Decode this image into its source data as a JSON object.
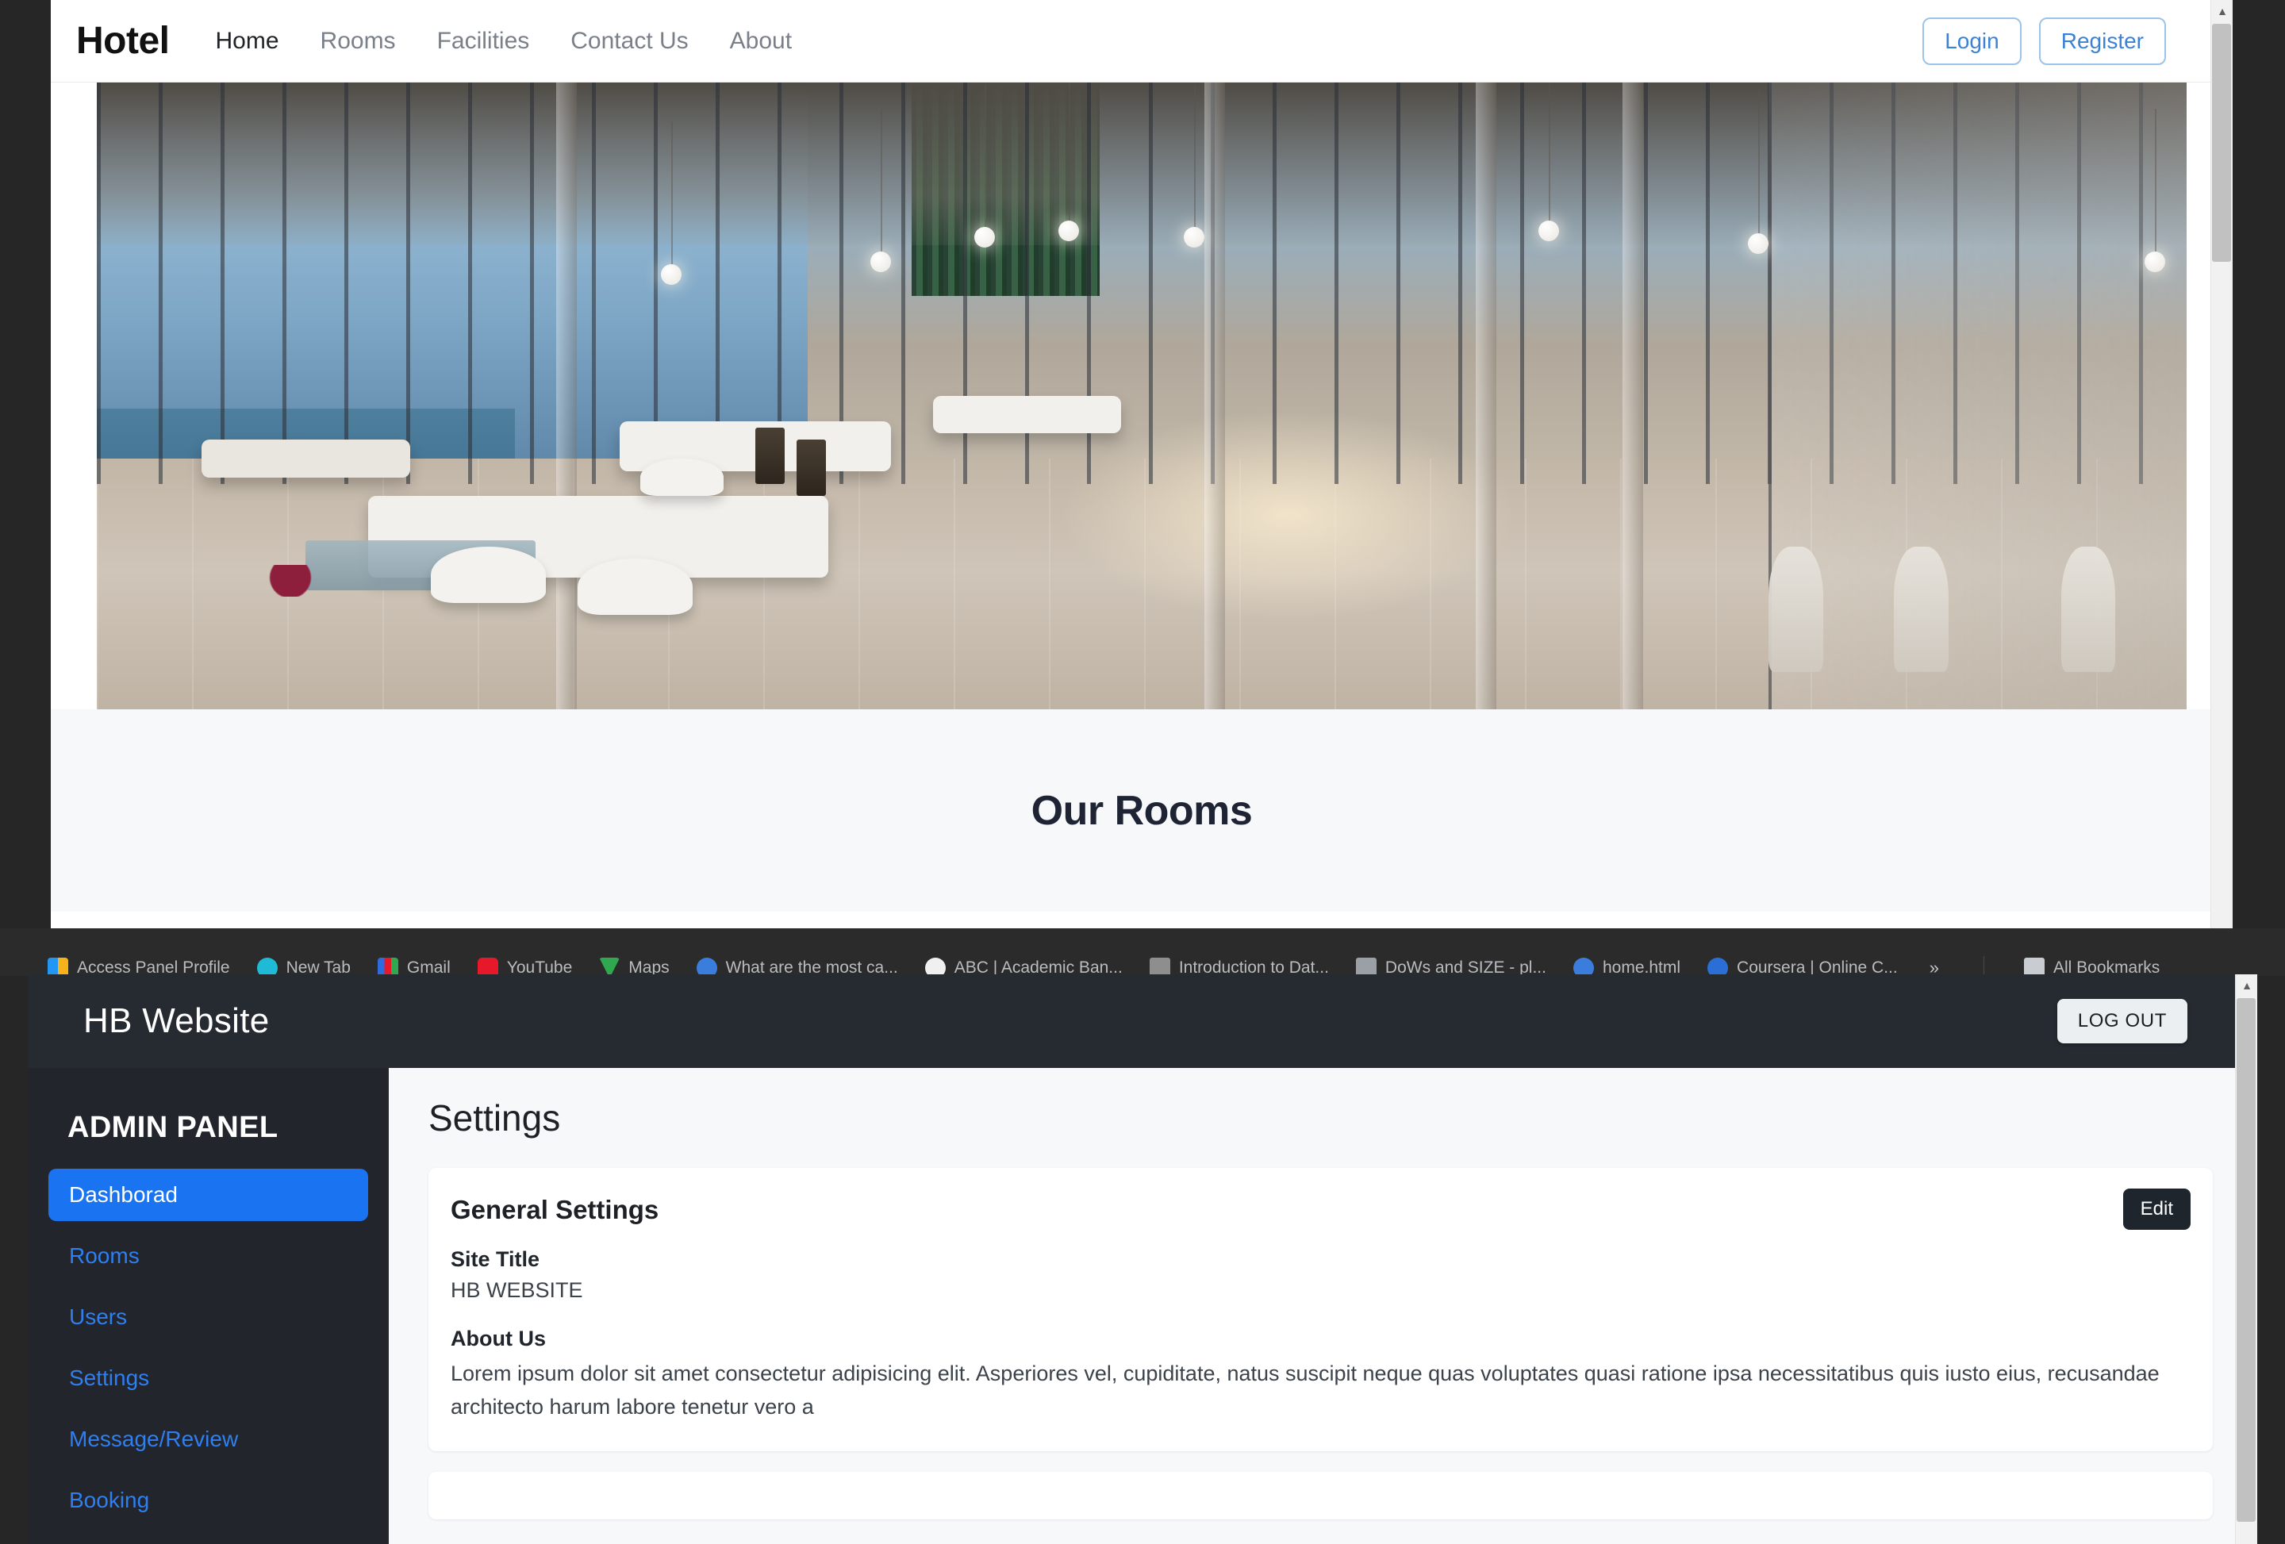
{
  "site": {
    "brand": "Hotel",
    "nav": [
      {
        "label": "Home",
        "active": true
      },
      {
        "label": "Rooms",
        "active": false
      },
      {
        "label": "Facilities",
        "active": false
      },
      {
        "label": "Contact Us",
        "active": false
      },
      {
        "label": "About",
        "active": false
      }
    ],
    "login_label": "Login",
    "register_label": "Register",
    "rooms_heading": "Our Rooms",
    "accent_blue": "#3b82d6"
  },
  "bookmarks": {
    "items": [
      {
        "label": "Access Panel Profile",
        "color": "#f5b21a"
      },
      {
        "label": "New Tab",
        "color": "#1fbad6"
      },
      {
        "label": "Gmail",
        "color": "#2d6cdf"
      },
      {
        "label": "YouTube",
        "color": "#e8182b"
      },
      {
        "label": "Maps",
        "color": "#2fa84f"
      },
      {
        "label": "What are the most ca...",
        "color": "#3b7ddd"
      },
      {
        "label": "ABC | Academic Ban...",
        "color": "#f0f0f0"
      },
      {
        "label": "Introduction to Dat...",
        "color": "#8e8e8e"
      },
      {
        "label": "DoWs and SIZE - pl...",
        "color": "#9aa0a6"
      },
      {
        "label": "home.html",
        "color": "#3b7ddd"
      },
      {
        "label": "Coursera | Online C...",
        "color": "#2b6fd6"
      }
    ],
    "overflow_label": "»",
    "all_bookmarks_label": "All Bookmarks"
  },
  "admin": {
    "brand": "HB Website",
    "logout_label": "LOG OUT",
    "sidebar_title": "ADMIN PANEL",
    "sidebar_items": [
      {
        "label": "Dashborad",
        "active": true
      },
      {
        "label": "Rooms",
        "active": false
      },
      {
        "label": "Users",
        "active": false
      },
      {
        "label": "Settings",
        "active": false
      },
      {
        "label": "Message/Review",
        "active": false
      },
      {
        "label": "Booking",
        "active": false
      }
    ],
    "page_title": "Settings",
    "card": {
      "title": "General Settings",
      "edit_label": "Edit",
      "site_title_label": "Site Title",
      "site_title_value": "HB WEBSITE",
      "about_label": "About Us",
      "about_value": "Lorem ipsum dolor sit amet consectetur adipisicing elit. Asperiores vel, cupiditate, natus suscipit neque quas voluptates quasi ratione ipsa necessitatibus quis iusto eius, recusandae architecto harum labore tenetur vero a"
    },
    "active_accent": "#1a73f0",
    "link_color": "#2f7ff0"
  }
}
